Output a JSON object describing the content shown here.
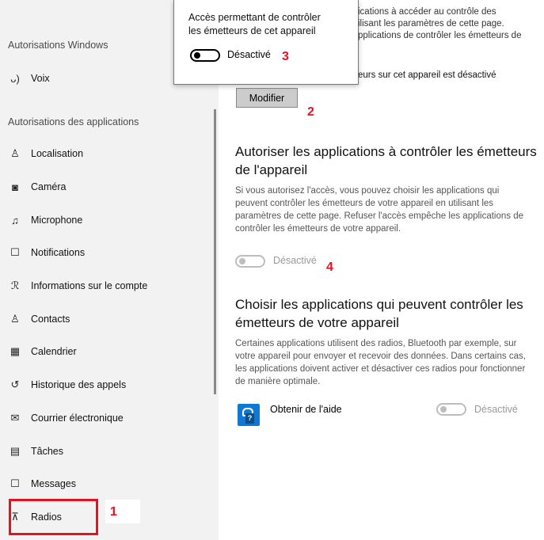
{
  "sidebar": {
    "heading_windows": "Autorisations Windows",
    "item_voice": {
      "label": "Voix",
      "icon": "voice-icon"
    },
    "heading_apps": "Autorisations des applications",
    "items": [
      {
        "label": "Localisation",
        "icon": "location-icon"
      },
      {
        "label": "Caméra",
        "icon": "camera-icon"
      },
      {
        "label": "Microphone",
        "icon": "microphone-icon"
      },
      {
        "label": "Notifications",
        "icon": "notifications-icon"
      },
      {
        "label": "Informations sur le compte",
        "icon": "account-info-icon"
      },
      {
        "label": "Contacts",
        "icon": "contacts-icon"
      },
      {
        "label": "Calendrier",
        "icon": "calendar-icon"
      },
      {
        "label": "Historique des appels",
        "icon": "call-history-icon"
      },
      {
        "label": "Courrier électronique",
        "icon": "email-icon"
      },
      {
        "label": "Tâches",
        "icon": "tasks-icon"
      },
      {
        "label": "Messages",
        "icon": "messages-icon"
      },
      {
        "label": "Radios",
        "icon": "radios-icon"
      }
    ]
  },
  "popup": {
    "line1": "Accès permettant de contrôler",
    "line2": "les émetteurs de cet appareil",
    "toggle_label": "Désactivé"
  },
  "top_partial": {
    "line1": "ications à accéder au contrôle des",
    "line2": "ilisant les paramètres de cette page.",
    "line3": "pplications de contrôler les émetteurs de",
    "status": "eurs sur cet appareil est désactivé"
  },
  "modify_button": "Modifier",
  "section_allow": {
    "heading_line1": "Autoriser les applications à contrôler les émetteurs",
    "heading_line2": "de l'appareil",
    "desc_line1": "Si vous autorisez l'accès, vous pouvez choisir les applications qui",
    "desc_line2": "peuvent contrôler les émetteurs de votre appareil en utilisant les",
    "desc_line3": "paramètres de cette page. Refuser l'accès empêche les applications de",
    "desc_line4": "contrôler les émetteurs de votre appareil.",
    "toggle_label": "Désactivé"
  },
  "section_choose": {
    "heading_line1": "Choisir les applications qui peuvent contrôler les",
    "heading_line2": "émetteurs de votre appareil",
    "desc_line1": "Certaines applications utilisent des radios, Bluetooth par exemple, sur",
    "desc_line2": "votre appareil pour envoyer et recevoir des données. Dans certains cas,",
    "desc_line3": "les applications doivent activer et désactiver ces radios pour fonctionner",
    "desc_line4": "de manière optimale.",
    "app_name": "Obtenir de l'aide",
    "app_icon": "get-help-icon",
    "app_toggle_label": "Désactivé"
  },
  "annotations": [
    "1",
    "2",
    "3",
    "4"
  ],
  "colors": {
    "accent": "#0f78d4",
    "annotation": "#e81123",
    "sidebar_bg": "#f2f2f2"
  }
}
